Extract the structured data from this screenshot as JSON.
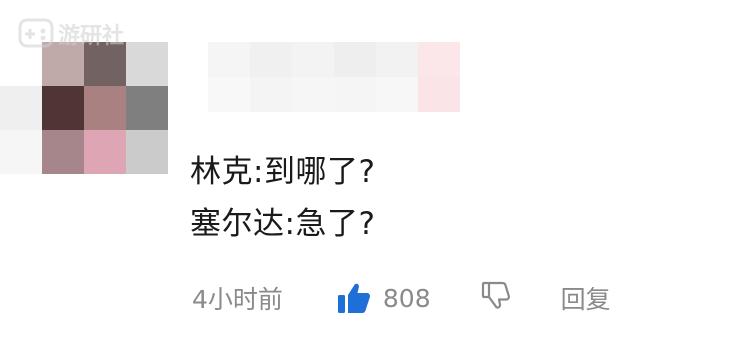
{
  "watermark": {
    "text": "游研社",
    "icon": "gamepad-logo-icon"
  },
  "comment": {
    "line1": "林克:到哪了?",
    "line2": "塞尔达:急了?"
  },
  "actions": {
    "time": "4小时前",
    "like_icon": "thumbs-up-icon",
    "like_count": "808",
    "dislike_icon": "thumbs-down-icon",
    "reply_label": "回复"
  },
  "colors": {
    "like_blue": "#1f6fd8",
    "meta_gray": "#8a8a8a",
    "text_dark": "#1a1a1a"
  }
}
